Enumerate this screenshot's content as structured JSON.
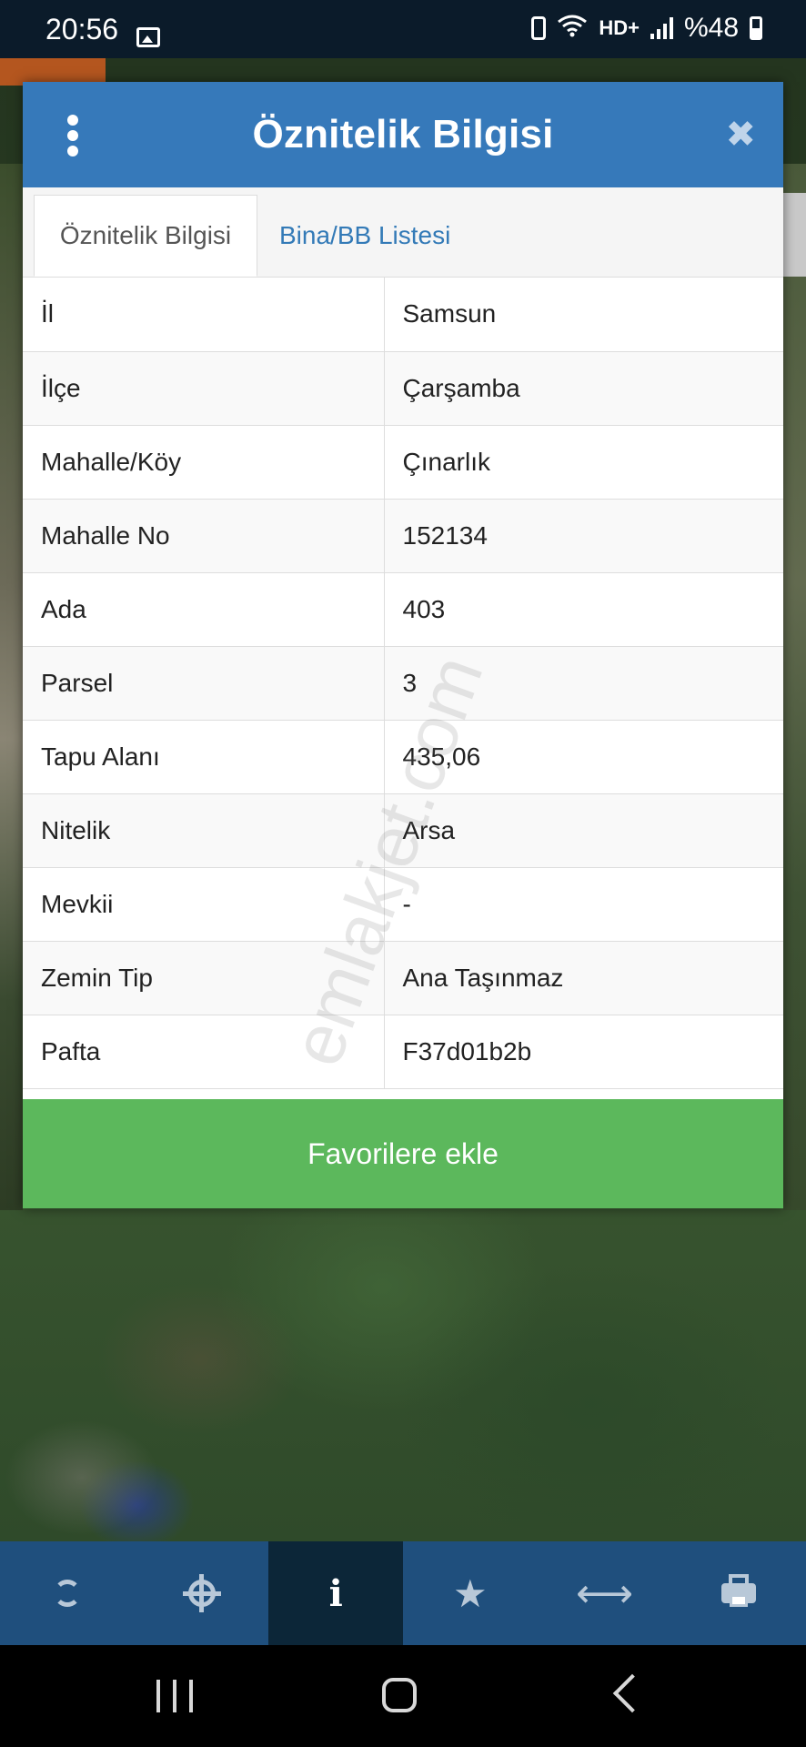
{
  "status_bar": {
    "time": "20:56",
    "hd_label": "HD+",
    "battery_text": "%48",
    "icons": [
      "image-icon",
      "battery-saver-icon",
      "wifi-icon",
      "hd-plus-icon",
      "signal-icon",
      "battery-icon"
    ]
  },
  "modal": {
    "title": "Öznitelik Bilgisi",
    "close_glyph": "✖",
    "tabs": [
      {
        "label": "Öznitelik Bilgisi",
        "active": true
      },
      {
        "label": "Bina/BB Listesi",
        "active": false
      }
    ],
    "rows": [
      {
        "key": "İl",
        "value": "Samsun"
      },
      {
        "key": "İlçe",
        "value": "Çarşamba"
      },
      {
        "key": "Mahalle/Köy",
        "value": "Çınarlık"
      },
      {
        "key": "Mahalle No",
        "value": "152134"
      },
      {
        "key": "Ada",
        "value": "403"
      },
      {
        "key": "Parsel",
        "value": "3"
      },
      {
        "key": "Tapu Alanı",
        "value": "435,06"
      },
      {
        "key": "Nitelik",
        "value": "Arsa"
      },
      {
        "key": "Mevkii",
        "value": "-"
      },
      {
        "key": "Zemin Tip",
        "value": "Ana Taşınmaz"
      },
      {
        "key": "Pafta",
        "value": "F37d01b2b"
      }
    ],
    "favorite_button": "Favorilere ekle"
  },
  "watermark": "emlakjet.com",
  "toolbar": {
    "items": [
      "refresh-icon",
      "locate-icon",
      "info-icon",
      "star-icon",
      "measure-icon",
      "print-icon"
    ],
    "active_index": 2,
    "star_glyph": "★",
    "arrows_glyph": "⟷",
    "info_glyph": "i"
  },
  "colors": {
    "header_blue": "#3679ba",
    "tab_link_blue": "#337ab7",
    "button_green": "#5cb85c",
    "toolbar_blue": "#1f4f7d",
    "toolbar_active": "#0c2638"
  }
}
